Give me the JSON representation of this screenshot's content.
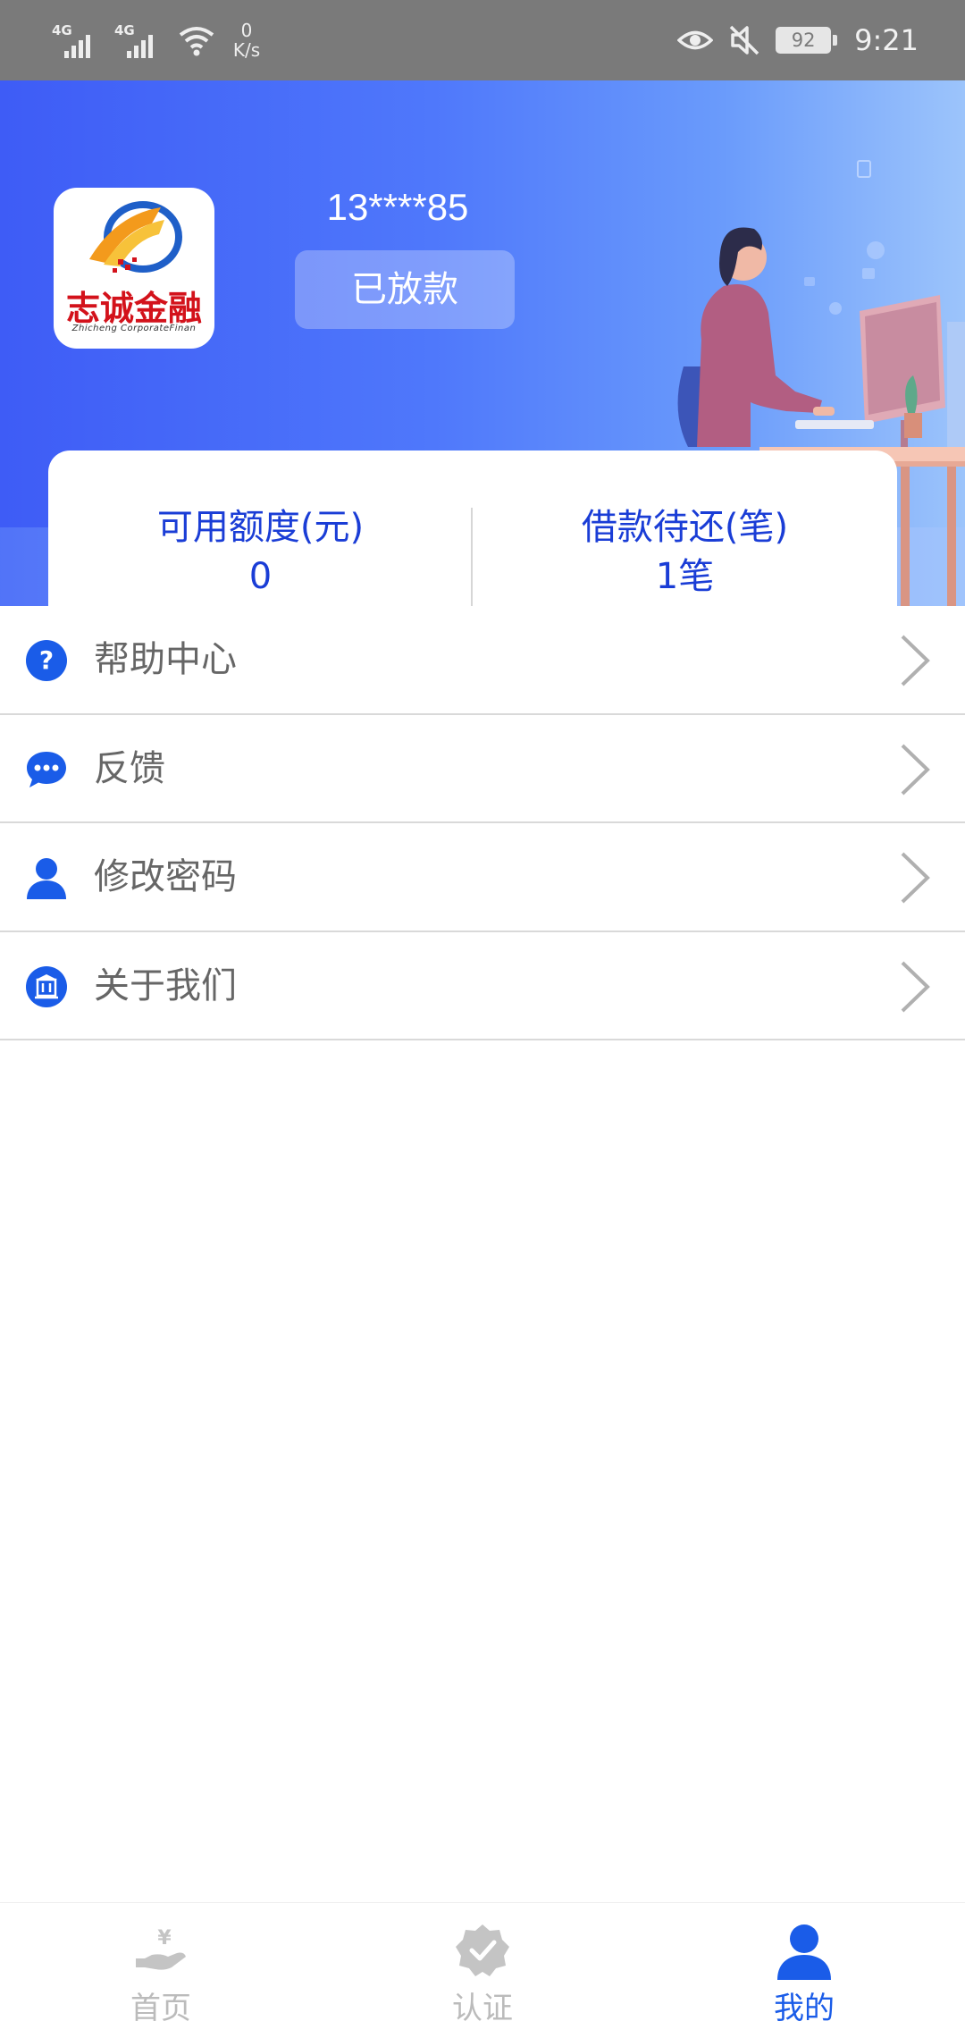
{
  "status_bar": {
    "network_1": "4G",
    "network_2": "4G",
    "speed_value": "0",
    "speed_unit": "K/s",
    "battery": "92",
    "time": "9:21"
  },
  "profile": {
    "logo_text": "志诚金融",
    "logo_subtext": "Zhicheng CorporateFinan",
    "phone": "13****85",
    "loan_status": "已放款"
  },
  "summary": {
    "available_label": "可用额度(元)",
    "available_value": "0",
    "pending_label": "借款待还(笔)",
    "pending_value": "1笔"
  },
  "menu": [
    {
      "label": "帮助中心",
      "icon": "question-icon"
    },
    {
      "label": "反馈",
      "icon": "chat-bubble-icon"
    },
    {
      "label": "修改密码",
      "icon": "user-icon"
    },
    {
      "label": "关于我们",
      "icon": "building-icon"
    }
  ],
  "bottom_nav": [
    {
      "label": "首页",
      "icon": "hand-yuan-icon",
      "active": false
    },
    {
      "label": "认证",
      "icon": "verified-badge-icon",
      "active": false
    },
    {
      "label": "我的",
      "icon": "user-icon",
      "active": true
    }
  ],
  "colors": {
    "accent": "#1a5ce8",
    "primary_text": "#1a3dd6",
    "inactive_nav": "#bbbbbb",
    "menu_text": "#666666"
  }
}
